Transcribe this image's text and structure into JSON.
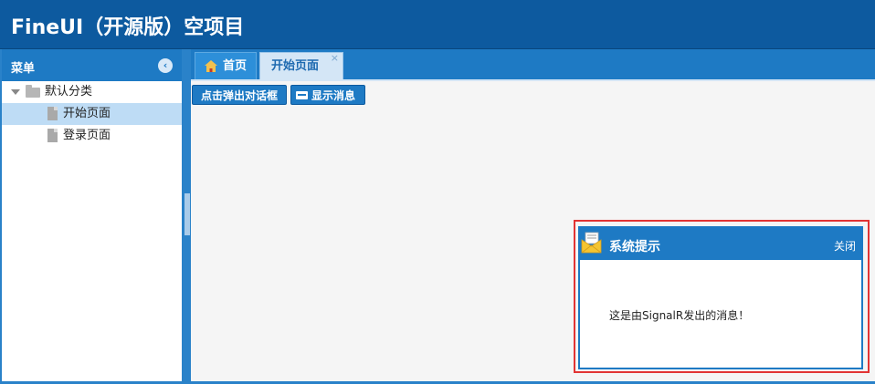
{
  "app": {
    "title": "FineUI（开源版）空项目"
  },
  "sidebar": {
    "title": "菜单",
    "collapse_icon": "chevron-left-circle-icon",
    "tree": {
      "folder": "默认分类",
      "items": [
        {
          "label": "开始页面",
          "selected": true
        },
        {
          "label": "登录页面",
          "selected": false
        }
      ]
    }
  },
  "tabs": [
    {
      "label": "首页",
      "icon": "home-icon"
    },
    {
      "label": "开始页面",
      "active": true,
      "close": "×"
    }
  ],
  "toolbar": {
    "dialog_button": "点击弹出对话框",
    "message_button": "显示消息"
  },
  "notification": {
    "title": "系统提示",
    "close": "关闭",
    "message": "这是由SignalR发出的消息！"
  },
  "colors": {
    "header": "#0d5a9f",
    "accent": "#1e7ac4",
    "selected_row": "#bedcf5",
    "highlight_border": "#e23434"
  }
}
